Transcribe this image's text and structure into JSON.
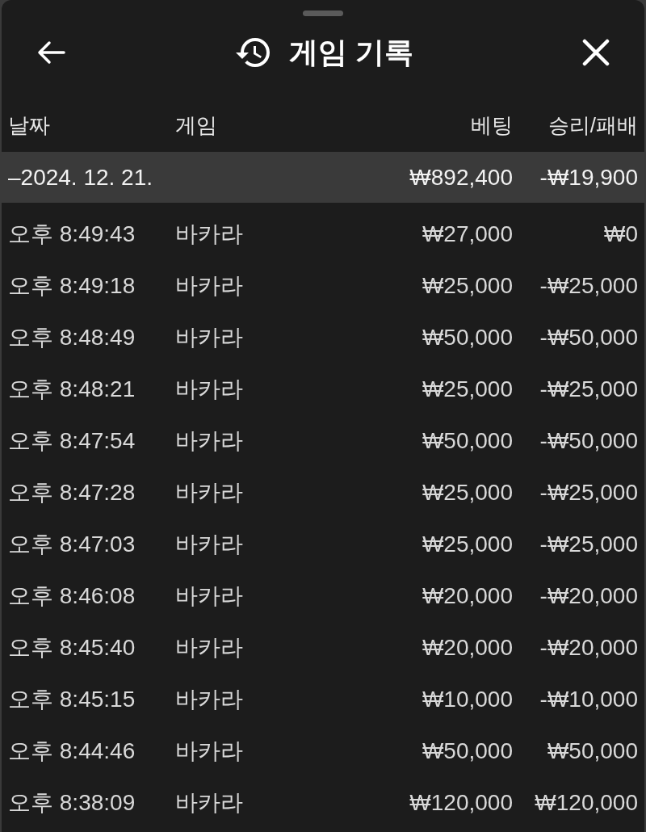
{
  "sheet": {
    "title": "게임 기록"
  },
  "table": {
    "columns": [
      "날짜",
      "게임",
      "베팅",
      "승리/패배"
    ],
    "groups": [
      {
        "label": "–2024. 12. 21.",
        "bet_total": "₩892,400",
        "result_total": "-₩19,900",
        "rows": [
          {
            "time": "오후 8:49:43",
            "game": "바카라",
            "bet": "₩27,000",
            "result": "₩0"
          },
          {
            "time": "오후 8:49:18",
            "game": "바카라",
            "bet": "₩25,000",
            "result": "-₩25,000"
          },
          {
            "time": "오후 8:48:49",
            "game": "바카라",
            "bet": "₩50,000",
            "result": "-₩50,000"
          },
          {
            "time": "오후 8:48:21",
            "game": "바카라",
            "bet": "₩25,000",
            "result": "-₩25,000"
          },
          {
            "time": "오후 8:47:54",
            "game": "바카라",
            "bet": "₩50,000",
            "result": "-₩50,000"
          },
          {
            "time": "오후 8:47:28",
            "game": "바카라",
            "bet": "₩25,000",
            "result": "-₩25,000"
          },
          {
            "time": "오후 8:47:03",
            "game": "바카라",
            "bet": "₩25,000",
            "result": "-₩25,000"
          },
          {
            "time": "오후 8:46:08",
            "game": "바카라",
            "bet": "₩20,000",
            "result": "-₩20,000"
          },
          {
            "time": "오후 8:45:40",
            "game": "바카라",
            "bet": "₩20,000",
            "result": "-₩20,000"
          },
          {
            "time": "오후 8:45:15",
            "game": "바카라",
            "bet": "₩10,000",
            "result": "-₩10,000"
          },
          {
            "time": "오후 8:44:46",
            "game": "바카라",
            "bet": "₩50,000",
            "result": "₩50,000"
          },
          {
            "time": "오후 8:38:09",
            "game": "바카라",
            "bet": "₩120,000",
            "result": "₩120,000"
          }
        ]
      }
    ]
  }
}
